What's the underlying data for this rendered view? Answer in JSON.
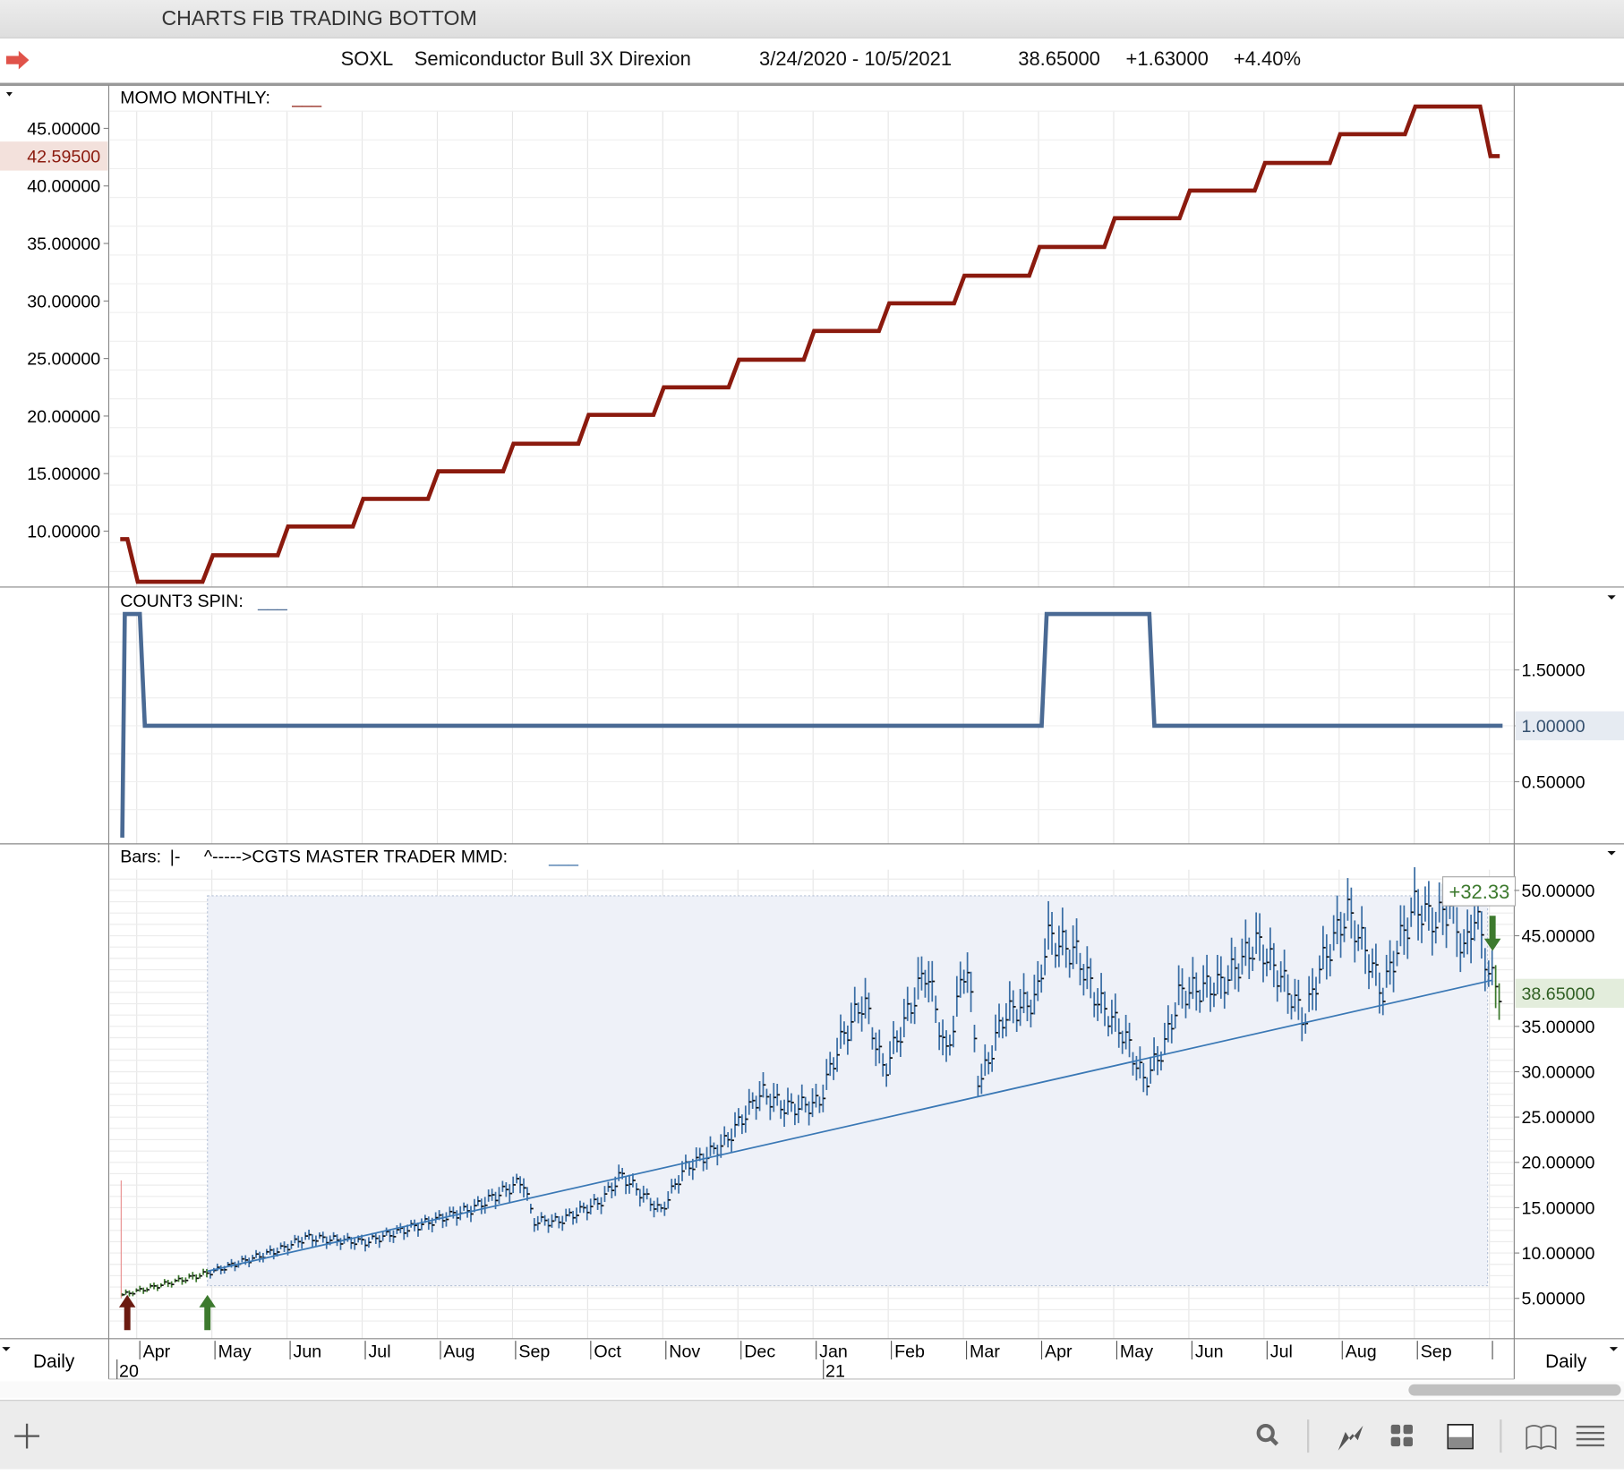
{
  "window": {
    "title": "CHARTS FIB TRADING BOTTOM"
  },
  "header": {
    "symbol": "SOXL",
    "name": "Semiconductor Bull 3X Direxion",
    "date_range": "3/24/2020 - 10/5/2021",
    "last": "38.65000",
    "change": "+1.63000",
    "change_pct": "+4.40%"
  },
  "colors": {
    "momo": "#8b1a0e",
    "spin": "#4a6a94",
    "bars": "#3a6ea5",
    "bars_early": "#3d7a2e",
    "accent_green": "#3d7a2e",
    "trend": "#3a78b5"
  },
  "chart_data": [
    {
      "type": "line",
      "title": "MOMO MONTHLY:",
      "legend_mark": "___",
      "y_ticks": [
        "45.00000",
        "40.00000",
        "35.00000",
        "30.00000",
        "25.00000",
        "20.00000",
        "15.00000",
        "10.00000"
      ],
      "y_tick_values": [
        45,
        40,
        35,
        30,
        25,
        20,
        15,
        10
      ],
      "ylim": [
        3.5,
        50
      ],
      "current_label": "42.59500",
      "current_value": 42.595,
      "months": [
        "2020-03",
        "2020-04",
        "2020-05",
        "2020-06",
        "2020-07",
        "2020-08",
        "2020-09",
        "2020-10",
        "2020-11",
        "2020-12",
        "2021-01",
        "2021-02",
        "2021-03",
        "2021-04",
        "2021-05",
        "2021-06",
        "2021-07",
        "2021-08",
        "2021-09",
        "2021-10"
      ],
      "values": [
        9.3,
        5.6,
        7.9,
        10.4,
        12.8,
        15.2,
        17.6,
        20.1,
        22.5,
        24.9,
        27.4,
        29.8,
        32.2,
        34.7,
        37.2,
        39.6,
        42.0,
        44.5,
        46.9,
        42.595
      ]
    },
    {
      "type": "line",
      "title": "COUNT3 SPIN:",
      "legend_mark": "___",
      "y_ticks": [
        "1.50000",
        "1.00000",
        "0.50000"
      ],
      "y_tick_values": [
        1.5,
        1.0,
        0.5
      ],
      "ylim": [
        0,
        2.05
      ],
      "current_label": "1.00000",
      "points": [
        [
          "2020-03-24",
          0
        ],
        [
          "2020-03-25",
          2
        ],
        [
          "2020-04-01",
          2
        ],
        [
          "2020-04-03",
          1
        ],
        [
          "2021-04-01",
          1
        ],
        [
          "2021-04-03",
          2
        ],
        [
          "2021-05-14",
          2
        ],
        [
          "2021-05-16",
          1
        ],
        [
          "2021-10-05",
          1
        ]
      ]
    },
    {
      "type": "bar-ohlc",
      "title": "Bars:",
      "bar_style": "|-",
      "indicator": "^----->CGTS MASTER TRADER MMD:",
      "legend_mark": "___",
      "y_ticks": [
        "50.00000",
        "45.00000",
        "35.00000",
        "30.00000",
        "25.00000",
        "20.00000",
        "15.00000",
        "10.00000",
        "5.00000"
      ],
      "y_tick_values": [
        50,
        45,
        35,
        30,
        25,
        20,
        15,
        10,
        5
      ],
      "ylim": [
        2,
        54
      ],
      "current_label": "38.65000",
      "gain_label": "+32.33",
      "price_path": [
        [
          "2020-03-24",
          5.4
        ],
        [
          "2020-04-27",
          7.7
        ],
        [
          "2020-05-29",
          10.6
        ],
        [
          "2020-06-07",
          11.7
        ],
        [
          "2020-07-01",
          11.2
        ],
        [
          "2020-08-03",
          14
        ],
        [
          "2020-08-13",
          14.8
        ],
        [
          "2020-09-04",
          18
        ],
        [
          "2020-09-08",
          13.5
        ],
        [
          "2020-09-18",
          13.5
        ],
        [
          "2020-10-05",
          15.7
        ],
        [
          "2020-10-13",
          18.6
        ],
        [
          "2020-10-29",
          14.6
        ],
        [
          "2020-11-08",
          19.2
        ],
        [
          "2020-11-24",
          22
        ],
        [
          "2020-12-09",
          27.7
        ],
        [
          "2020-12-19",
          26
        ],
        [
          "2021-01-02",
          26.5
        ],
        [
          "2021-01-10",
          32.9
        ],
        [
          "2021-01-20",
          38
        ],
        [
          "2021-01-28",
          30
        ],
        [
          "2021-02-15",
          41.4
        ],
        [
          "2021-02-23",
          31.7
        ],
        [
          "2021-03-01",
          42.6
        ],
        [
          "2021-03-06",
          28.3
        ],
        [
          "2021-03-16",
          36.3
        ],
        [
          "2021-03-29",
          38
        ],
        [
          "2021-04-03",
          44.9
        ],
        [
          "2021-04-15",
          43
        ],
        [
          "2021-04-23",
          38
        ],
        [
          "2021-05-04",
          34
        ],
        [
          "2021-05-12",
          28.9
        ],
        [
          "2021-05-20",
          32.9
        ],
        [
          "2021-05-26",
          38.6
        ],
        [
          "2021-06-13",
          39.7
        ],
        [
          "2021-06-27",
          44.3
        ],
        [
          "2021-07-08",
          39.7
        ],
        [
          "2021-07-16",
          35.7
        ],
        [
          "2021-07-22",
          41.4
        ],
        [
          "2021-08-03",
          47.7
        ],
        [
          "2021-08-11",
          43
        ],
        [
          "2021-08-17",
          38.6
        ],
        [
          "2021-08-23",
          43.7
        ],
        [
          "2021-08-30",
          48.3
        ],
        [
          "2021-09-08",
          46.6
        ],
        [
          "2021-09-14",
          48.3
        ],
        [
          "2021-09-20",
          43
        ],
        [
          "2021-09-24",
          47.7
        ],
        [
          "2021-09-30",
          40.3
        ],
        [
          "2021-10-05",
          38.65
        ]
      ],
      "trendline": [
        [
          "2020-04-28",
          8.0
        ],
        [
          "2021-10-01",
          40.1
        ]
      ],
      "range_box": {
        "start": "2020-04-28",
        "end": "2021-09-29",
        "low": 6.4,
        "high": 49.4
      },
      "signals": [
        {
          "date": "2020-03-26",
          "type": "up",
          "color": "#6b1a10"
        },
        {
          "date": "2020-04-28",
          "type": "up",
          "color": "#3d7a2e"
        },
        {
          "date": "2021-10-01",
          "type": "down",
          "color": "#3d7a2e"
        }
      ]
    }
  ],
  "time_axis": {
    "period_left": "Daily",
    "period_right": "Daily",
    "months": [
      "Apr",
      "May",
      "Jun",
      "Jul",
      "Aug",
      "Sep",
      "Oct",
      "Nov",
      "Dec",
      "Jan",
      "Feb",
      "Mar",
      "Apr",
      "May",
      "Jun",
      "Jul",
      "Aug",
      "Sep"
    ],
    "years": [
      "20",
      "21"
    ]
  },
  "toolbar": {
    "icons": [
      "add-icon",
      "search-icon",
      "chart-line-icon",
      "grid-icon",
      "panel-icon",
      "book-icon",
      "menu-icon"
    ]
  }
}
